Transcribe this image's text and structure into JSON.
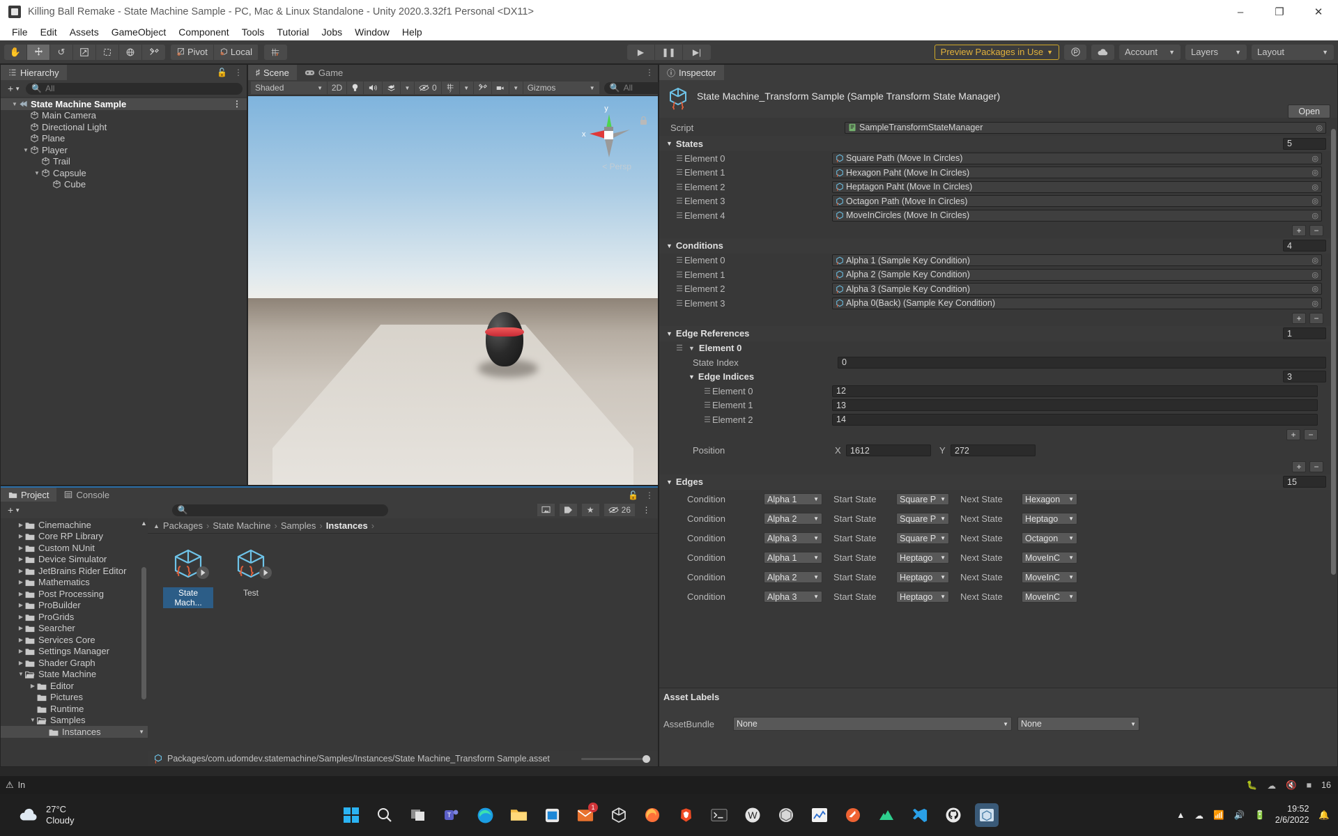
{
  "window": {
    "title": "Killing Ball Remake - State Machine Sample - PC, Mac & Linux Standalone - Unity 2020.3.32f1 Personal <DX11>",
    "minimize": "–",
    "maximize": "❐",
    "close": "✕"
  },
  "menu": [
    "File",
    "Edit",
    "Assets",
    "GameObject",
    "Component",
    "Tools",
    "Tutorial",
    "Jobs",
    "Window",
    "Help"
  ],
  "toolbar": {
    "tools": [
      "hand-tool",
      "move-tool",
      "rotate-tool",
      "scale-tool",
      "rect-tool",
      "transform-tool",
      "custom-tool"
    ],
    "pivot_label": "Pivot",
    "local_label": "Local",
    "grid_snap": "grid-snap",
    "play": "▶",
    "pause": "❚❚",
    "step": "▶|",
    "preview_packages": "Preview Packages in Use",
    "collab_icon": "collab-icon",
    "cloud_icon": "cloud-icon",
    "account_label": "Account",
    "layers_label": "Layers",
    "layout_label": "Layout"
  },
  "hierarchy": {
    "tab": "Hierarchy",
    "search_placeholder": "All",
    "items": [
      {
        "label": "State Machine Sample",
        "depth": 0,
        "arrow": "▼",
        "selected": true,
        "icon": "scene-icon"
      },
      {
        "label": "Main Camera",
        "depth": 1,
        "arrow": "",
        "selected": false,
        "icon": "gameobject-icon"
      },
      {
        "label": "Directional Light",
        "depth": 1,
        "arrow": "",
        "selected": false,
        "icon": "gameobject-icon"
      },
      {
        "label": "Plane",
        "depth": 1,
        "arrow": "",
        "selected": false,
        "icon": "gameobject-icon"
      },
      {
        "label": "Player",
        "depth": 1,
        "arrow": "▼",
        "selected": false,
        "icon": "gameobject-icon"
      },
      {
        "label": "Trail",
        "depth": 2,
        "arrow": "",
        "selected": false,
        "icon": "gameobject-icon"
      },
      {
        "label": "Capsule",
        "depth": 2,
        "arrow": "▼",
        "selected": false,
        "icon": "gameobject-icon"
      },
      {
        "label": "Cube",
        "depth": 3,
        "arrow": "",
        "selected": false,
        "icon": "gameobject-icon"
      }
    ]
  },
  "scene": {
    "tabs": [
      {
        "label": "Scene",
        "active": true
      },
      {
        "label": "Game",
        "active": false
      }
    ],
    "shading": "Shaded",
    "mode_2d": "2D",
    "lighting_icon": "lighting-icon",
    "audio_icon": "audio-icon",
    "fx_icon": "effects-icon",
    "hidden_count": "0",
    "grid_icon": "grid-icon",
    "camera_icon": "camera-icon",
    "gizmos_label": "Gizmos",
    "search_placeholder": "All",
    "axis_x": "x",
    "axis_y": "y",
    "perspective": "Persp"
  },
  "project": {
    "tabs": [
      {
        "label": "Project",
        "active": true
      },
      {
        "label": "Console",
        "active": false
      }
    ],
    "search_placeholder": "",
    "item_count": "26",
    "tree": [
      {
        "label": "Cinemachine",
        "depth": 1,
        "arrow": "▶",
        "open": false
      },
      {
        "label": "Core RP Library",
        "depth": 1,
        "arrow": "▶",
        "open": false
      },
      {
        "label": "Custom NUnit",
        "depth": 1,
        "arrow": "▶",
        "open": false
      },
      {
        "label": "Device Simulator",
        "depth": 1,
        "arrow": "▶",
        "open": false
      },
      {
        "label": "JetBrains Rider Editor",
        "depth": 1,
        "arrow": "▶",
        "open": false
      },
      {
        "label": "Mathematics",
        "depth": 1,
        "arrow": "▶",
        "open": false
      },
      {
        "label": "Post Processing",
        "depth": 1,
        "arrow": "▶",
        "open": false
      },
      {
        "label": "ProBuilder",
        "depth": 1,
        "arrow": "▶",
        "open": false
      },
      {
        "label": "ProGrids",
        "depth": 1,
        "arrow": "▶",
        "open": false
      },
      {
        "label": "Searcher",
        "depth": 1,
        "arrow": "▶",
        "open": false
      },
      {
        "label": "Services Core",
        "depth": 1,
        "arrow": "▶",
        "open": false
      },
      {
        "label": "Settings Manager",
        "depth": 1,
        "arrow": "▶",
        "open": false
      },
      {
        "label": "Shader Graph",
        "depth": 1,
        "arrow": "▶",
        "open": false
      },
      {
        "label": "State Machine",
        "depth": 1,
        "arrow": "▼",
        "open": true
      },
      {
        "label": "Editor",
        "depth": 2,
        "arrow": "▶",
        "open": false
      },
      {
        "label": "Pictures",
        "depth": 2,
        "arrow": "",
        "open": false
      },
      {
        "label": "Runtime",
        "depth": 2,
        "arrow": "",
        "open": false
      },
      {
        "label": "Samples",
        "depth": 2,
        "arrow": "▼",
        "open": true
      },
      {
        "label": "Instances",
        "depth": 3,
        "arrow": "",
        "open": false,
        "selected": true
      }
    ],
    "breadcrumb": [
      "Packages",
      "State Machine",
      "Samples",
      "Instances"
    ],
    "assets": [
      {
        "label": "State Mach...",
        "selected": true,
        "icon": "prefab-variant-icon"
      },
      {
        "label": "Test",
        "selected": false,
        "icon": "prefab-variant-icon"
      }
    ],
    "path": "Packages/com.udomdev.statemachine/Samples/Instances/State Machine_Transform Sample.asset"
  },
  "inspector": {
    "tab": "Inspector",
    "object_title": "State Machine_Transform Sample (Sample Transform State Manager)",
    "open_button": "Open",
    "script_label": "Script",
    "script_value": "SampleTransformStateManager",
    "states": {
      "title": "States",
      "count": "5",
      "elements": [
        {
          "label": "Element 0",
          "value": "Square Path (Move In Circles)"
        },
        {
          "label": "Element 1",
          "value": "Hexagon Paht (Move In Circles)"
        },
        {
          "label": "Element 2",
          "value": "Heptagon Paht (Move In Circles)"
        },
        {
          "label": "Element 3",
          "value": "Octagon Path (Move In Circles)"
        },
        {
          "label": "Element 4",
          "value": "MoveInCircles (Move In Circles)"
        }
      ]
    },
    "conditions": {
      "title": "Conditions",
      "count": "4",
      "elements": [
        {
          "label": "Element 0",
          "value": "Alpha 1 (Sample Key Condition)"
        },
        {
          "label": "Element 1",
          "value": "Alpha 2 (Sample Key Condition)"
        },
        {
          "label": "Element 2",
          "value": "Alpha 3 (Sample Key Condition)"
        },
        {
          "label": "Element 3",
          "value": "Alpha 0(Back) (Sample Key Condition)"
        }
      ]
    },
    "edge_references": {
      "title": "Edge References",
      "count": "1",
      "element_label": "Element 0",
      "state_index_label": "State Index",
      "state_index_value": "0",
      "edge_indices_label": "Edge Indices",
      "edge_indices_count": "3",
      "edge_indices": [
        {
          "label": "Element 0",
          "value": "12"
        },
        {
          "label": "Element 1",
          "value": "13"
        },
        {
          "label": "Element 2",
          "value": "14"
        }
      ],
      "position_label": "Position",
      "position_x_label": "X",
      "position_x": "1612",
      "position_y_label": "Y",
      "position_y": "272"
    },
    "edges": {
      "title": "Edges",
      "count": "15",
      "condition_label": "Condition",
      "start_state_label": "Start State",
      "next_state_label": "Next State",
      "rows": [
        {
          "condition": "Alpha 1",
          "start": "Square P",
          "next": "Hexagon"
        },
        {
          "condition": "Alpha 2",
          "start": "Square P",
          "next": "Heptago"
        },
        {
          "condition": "Alpha 3",
          "start": "Square P",
          "next": "Octagon"
        },
        {
          "condition": "Alpha 1",
          "start": "Heptago",
          "next": "MoveInC"
        },
        {
          "condition": "Alpha 2",
          "start": "Heptago",
          "next": "MoveInC"
        },
        {
          "condition": "Alpha 3",
          "start": "Heptago",
          "next": "MoveInC"
        }
      ]
    },
    "asset_labels_title": "Asset Labels",
    "asset_bundle_label": "AssetBundle",
    "asset_bundle_value": "None",
    "asset_bundle_variant": "None",
    "plus": "+",
    "minus": "−"
  },
  "statusbar": {
    "message": "In",
    "icons": [
      "bug-icon",
      "cloud-status-icon",
      "mute-icon",
      "layers-status-icon"
    ],
    "counter": "16"
  },
  "taskbar": {
    "weather_temp": "27°C",
    "weather_desc": "Cloudy",
    "apps": [
      "start-icon",
      "search-icon",
      "taskview-icon",
      "teams-icon",
      "edge-icon",
      "explorer-icon",
      "store-icon",
      "mail-icon",
      "unity-hub-icon",
      "firefox-icon",
      "brave-icon",
      "terminal-icon",
      "wordpress-icon",
      "blender-icon",
      "chart-icon",
      "postman-icon",
      "nuxt-icon",
      "vscode-icon",
      "github-icon",
      "unity-icon"
    ],
    "mail_badge": "1",
    "time": "19:52",
    "date": "2/6/2022"
  },
  "colors": {
    "accent_orange": "#e2b23c",
    "selection_blue": "#2c5d87",
    "panel_bg": "#383838",
    "toolbar_bg": "#3c3c3c"
  }
}
